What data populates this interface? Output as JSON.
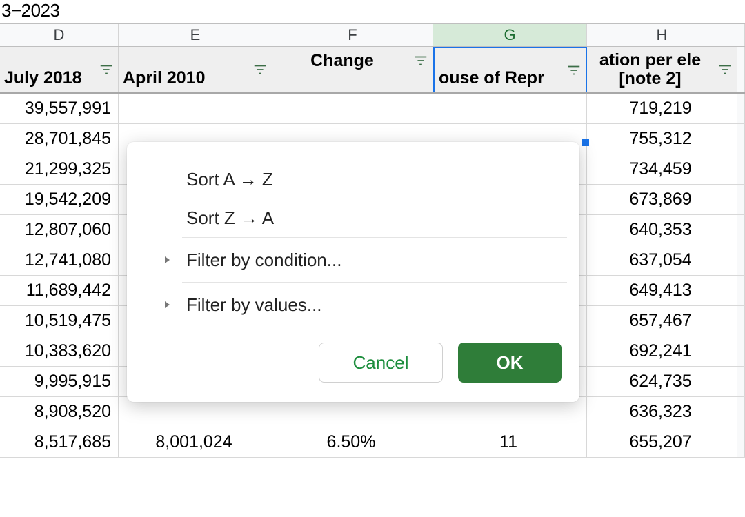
{
  "topbar": {
    "fragment": "3−2023"
  },
  "columns": {
    "d": "D",
    "e": "E",
    "f": "F",
    "g": "G",
    "h": "H"
  },
  "headers": {
    "d": "July 2018",
    "e": "April 2010",
    "f": "Change",
    "g": "ouse of Repr",
    "h_line1": "ation per ele",
    "h_line2": "[note 2]"
  },
  "rows": [
    {
      "d": "39,557,991",
      "e": "",
      "f": "",
      "g": "",
      "h": "719,219"
    },
    {
      "d": "28,701,845",
      "e": "",
      "f": "",
      "g": "",
      "h": "755,312"
    },
    {
      "d": "21,299,325",
      "e": "",
      "f": "",
      "g": "",
      "h": "734,459"
    },
    {
      "d": "19,542,209",
      "e": "",
      "f": "",
      "g": "",
      "h": "673,869"
    },
    {
      "d": "12,807,060",
      "e": "",
      "f": "",
      "g": "",
      "h": "640,353"
    },
    {
      "d": "12,741,080",
      "e": "",
      "f": "",
      "g": "",
      "h": "637,054"
    },
    {
      "d": "11,689,442",
      "e": "",
      "f": "",
      "g": "",
      "h": "649,413"
    },
    {
      "d": "10,519,475",
      "e": "",
      "f": "",
      "g": "",
      "h": "657,467"
    },
    {
      "d": "10,383,620",
      "e": "",
      "f": "",
      "g": "",
      "h": "692,241"
    },
    {
      "d": "9,995,915",
      "e": "",
      "f": "",
      "g": "",
      "h": "624,735"
    },
    {
      "d": "8,908,520",
      "e": "",
      "f": "",
      "g": "",
      "h": "636,323"
    },
    {
      "d": "8,517,685",
      "e": "8,001,024",
      "f": "6.50%",
      "g": "11",
      "h": "655,207"
    }
  ],
  "popup": {
    "sort_az": "Sort A → Z",
    "sort_za": "Sort Z → A",
    "filter_cond": "Filter by condition...",
    "filter_vals": "Filter by values...",
    "cancel": "Cancel",
    "ok": "OK"
  }
}
